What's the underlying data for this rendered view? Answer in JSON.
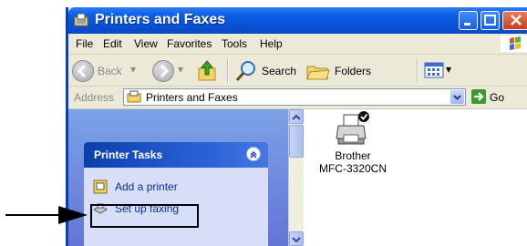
{
  "window": {
    "title": "Printers and Faxes"
  },
  "menu": {
    "items": [
      "File",
      "Edit",
      "View",
      "Favorites",
      "Tools",
      "Help"
    ]
  },
  "toolbar": {
    "back_label": "Back",
    "search_label": "Search",
    "folders_label": "Folders"
  },
  "address": {
    "label": "Address",
    "value": "Printers and Faxes",
    "go_label": "Go"
  },
  "tasks": {
    "title": "Printer Tasks",
    "items": [
      {
        "label": "Add a printer",
        "icon": "add-printer-icon"
      },
      {
        "label": "Set up faxing",
        "icon": "fax-icon"
      }
    ]
  },
  "printers": [
    {
      "name_line1": "Brother",
      "name_line2": "MFC-3320CN",
      "icon": "printer-icon",
      "default": true
    }
  ],
  "colors": {
    "titlebar": "#0551d6",
    "task_pane": "#6375d6",
    "link": "#0a2e9e"
  }
}
